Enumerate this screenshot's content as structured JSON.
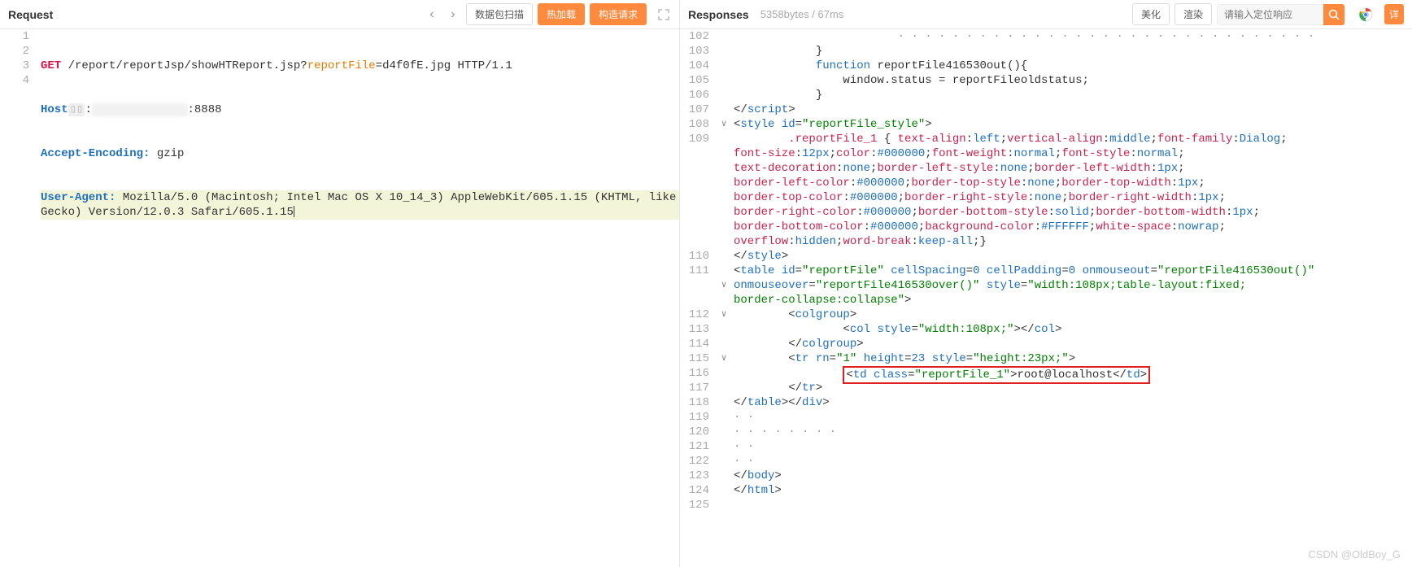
{
  "left": {
    "title": "Request",
    "nav_prev": "‹",
    "nav_next": "›",
    "btn_scan": "数据包扫描",
    "btn_hot": "热加载",
    "btn_build": "构造请求",
    "lines": [
      "1",
      "2",
      "3",
      "4"
    ],
    "l1": {
      "method": "GET",
      "path": "/report/reportJsp/showHTReport.jsp?",
      "param": "reportFile",
      "eq": "=d4f0fE.jpg",
      "proto": "HTTP/1.1"
    },
    "l2": {
      "header": "Host",
      "redacted": "▯▯",
      "dotsep": ":",
      "maskedhost": "              ",
      "port": ":8888"
    },
    "l3": {
      "header": "Accept-Encoding:",
      "value": "gzip"
    },
    "l4": {
      "header": "User-Agent:",
      "value": "Mozilla/5.0 (Macintosh; Intel Mac OS X 10_14_3) AppleWebKit/605.1.15 (KHTML, like Gecko) Version/12.0.3 Safari/605.1.15"
    }
  },
  "right": {
    "title": "Responses",
    "meta": "5358bytes / 67ms",
    "btn_beautify": "美化",
    "btn_render": "渲染",
    "search_placeholder": "请输入定位响应",
    "btn_detail": "详",
    "rows": [
      {
        "n": "102",
        "fold": "",
        "indent": 6,
        "segs": [
          {
            "c": "k-gray",
            "t": "· · · · · · · · · · · · · · · · · · · · · · · · · · · · · · ·"
          }
        ]
      },
      {
        "n": "103",
        "fold": "",
        "indent": 3,
        "segs": [
          {
            "c": "k-text",
            "t": "}"
          }
        ]
      },
      {
        "n": "104",
        "fold": "",
        "indent": 3,
        "segs": [
          {
            "c": "k-blue",
            "t": "function"
          },
          {
            "c": "k-text",
            "t": " reportFile416530out(){"
          }
        ]
      },
      {
        "n": "105",
        "fold": "",
        "indent": 4,
        "segs": [
          {
            "c": "k-text",
            "t": "window.status = reportFileoldstatus;"
          }
        ]
      },
      {
        "n": "106",
        "fold": "",
        "indent": 3,
        "segs": [
          {
            "c": "k-text",
            "t": "}"
          }
        ]
      },
      {
        "n": "107",
        "fold": "",
        "indent": 0,
        "segs": [
          {
            "c": "k-text",
            "t": "</"
          },
          {
            "c": "k-blue",
            "t": "script"
          },
          {
            "c": "k-text",
            "t": ">"
          }
        ]
      },
      {
        "n": "108",
        "fold": "∨",
        "indent": 0,
        "segs": [
          {
            "c": "k-text",
            "t": "<"
          },
          {
            "c": "k-blue",
            "t": "style"
          },
          {
            "c": "k-text",
            "t": " "
          },
          {
            "c": "k-blue",
            "t": "id"
          },
          {
            "c": "k-text",
            "t": "="
          },
          {
            "c": "k-str",
            "t": "\"reportFile_style\""
          },
          {
            "c": "k-text",
            "t": ">"
          }
        ]
      },
      {
        "n": "109",
        "fold": "",
        "multi": true,
        "indent": 2,
        "segs": [
          {
            "c": "k-red",
            "t": ".reportFile_1"
          },
          {
            "c": "k-text",
            "t": " { "
          },
          {
            "c": "k-red",
            "t": "text-align"
          },
          {
            "c": "k-text",
            "t": ":"
          },
          {
            "c": "k-blue",
            "t": "left"
          },
          {
            "c": "k-text",
            "t": ";"
          },
          {
            "c": "k-red",
            "t": "vertical-align"
          },
          {
            "c": "k-text",
            "t": ":"
          },
          {
            "c": "k-blue",
            "t": "middle"
          },
          {
            "c": "k-text",
            "t": ";"
          },
          {
            "c": "k-red",
            "t": "font-family"
          },
          {
            "c": "k-text",
            "t": ":"
          },
          {
            "c": "k-blue",
            "t": "Dialog"
          },
          {
            "c": "k-text",
            "t": ";\n"
          },
          {
            "c": "k-red",
            "t": "font-size"
          },
          {
            "c": "k-text",
            "t": ":"
          },
          {
            "c": "k-num",
            "t": "12px"
          },
          {
            "c": "k-text",
            "t": ";"
          },
          {
            "c": "k-red",
            "t": "color"
          },
          {
            "c": "k-text",
            "t": ":"
          },
          {
            "c": "k-blue",
            "t": "#000000"
          },
          {
            "c": "k-text",
            "t": ";"
          },
          {
            "c": "k-red",
            "t": "font-weight"
          },
          {
            "c": "k-text",
            "t": ":"
          },
          {
            "c": "k-blue",
            "t": "normal"
          },
          {
            "c": "k-text",
            "t": ";"
          },
          {
            "c": "k-red",
            "t": "font-style"
          },
          {
            "c": "k-text",
            "t": ":"
          },
          {
            "c": "k-blue",
            "t": "normal"
          },
          {
            "c": "k-text",
            "t": ";\n"
          },
          {
            "c": "k-red",
            "t": "text-decoration"
          },
          {
            "c": "k-text",
            "t": ":"
          },
          {
            "c": "k-blue",
            "t": "none"
          },
          {
            "c": "k-text",
            "t": ";"
          },
          {
            "c": "k-red",
            "t": "border-left-style"
          },
          {
            "c": "k-text",
            "t": ":"
          },
          {
            "c": "k-blue",
            "t": "none"
          },
          {
            "c": "k-text",
            "t": ";"
          },
          {
            "c": "k-red",
            "t": "border-left-width"
          },
          {
            "c": "k-text",
            "t": ":"
          },
          {
            "c": "k-num",
            "t": "1px"
          },
          {
            "c": "k-text",
            "t": ";\n"
          },
          {
            "c": "k-red",
            "t": "border-left-color"
          },
          {
            "c": "k-text",
            "t": ":"
          },
          {
            "c": "k-blue",
            "t": "#000000"
          },
          {
            "c": "k-text",
            "t": ";"
          },
          {
            "c": "k-red",
            "t": "border-top-style"
          },
          {
            "c": "k-text",
            "t": ":"
          },
          {
            "c": "k-blue",
            "t": "none"
          },
          {
            "c": "k-text",
            "t": ";"
          },
          {
            "c": "k-red",
            "t": "border-top-width"
          },
          {
            "c": "k-text",
            "t": ":"
          },
          {
            "c": "k-num",
            "t": "1px"
          },
          {
            "c": "k-text",
            "t": ";\n"
          },
          {
            "c": "k-red",
            "t": "border-top-color"
          },
          {
            "c": "k-text",
            "t": ":"
          },
          {
            "c": "k-blue",
            "t": "#000000"
          },
          {
            "c": "k-text",
            "t": ";"
          },
          {
            "c": "k-red",
            "t": "border-right-style"
          },
          {
            "c": "k-text",
            "t": ":"
          },
          {
            "c": "k-blue",
            "t": "none"
          },
          {
            "c": "k-text",
            "t": ";"
          },
          {
            "c": "k-red",
            "t": "border-right-width"
          },
          {
            "c": "k-text",
            "t": ":"
          },
          {
            "c": "k-num",
            "t": "1px"
          },
          {
            "c": "k-text",
            "t": ";\n"
          },
          {
            "c": "k-red",
            "t": "border-right-color"
          },
          {
            "c": "k-text",
            "t": ":"
          },
          {
            "c": "k-blue",
            "t": "#000000"
          },
          {
            "c": "k-text",
            "t": ";"
          },
          {
            "c": "k-red",
            "t": "border-bottom-style"
          },
          {
            "c": "k-text",
            "t": ":"
          },
          {
            "c": "k-blue",
            "t": "solid"
          },
          {
            "c": "k-text",
            "t": ";"
          },
          {
            "c": "k-red",
            "t": "border-bottom-width"
          },
          {
            "c": "k-text",
            "t": ":"
          },
          {
            "c": "k-num",
            "t": "1px"
          },
          {
            "c": "k-text",
            "t": ";\n"
          },
          {
            "c": "k-red",
            "t": "border-bottom-color"
          },
          {
            "c": "k-text",
            "t": ":"
          },
          {
            "c": "k-blue",
            "t": "#000000"
          },
          {
            "c": "k-text",
            "t": ";"
          },
          {
            "c": "k-red",
            "t": "background-color"
          },
          {
            "c": "k-text",
            "t": ":"
          },
          {
            "c": "k-blue",
            "t": "#FFFFFF"
          },
          {
            "c": "k-text",
            "t": ";"
          },
          {
            "c": "k-red",
            "t": "white-space"
          },
          {
            "c": "k-text",
            "t": ":"
          },
          {
            "c": "k-blue",
            "t": "nowrap"
          },
          {
            "c": "k-text",
            "t": ";\n"
          },
          {
            "c": "k-red",
            "t": "overflow"
          },
          {
            "c": "k-text",
            "t": ":"
          },
          {
            "c": "k-blue",
            "t": "hidden"
          },
          {
            "c": "k-text",
            "t": ";"
          },
          {
            "c": "k-red",
            "t": "word-break"
          },
          {
            "c": "k-text",
            "t": ":"
          },
          {
            "c": "k-blue",
            "t": "keep-all"
          },
          {
            "c": "k-text",
            "t": ";}"
          }
        ]
      },
      {
        "n": "110",
        "fold": "",
        "indent": 0,
        "segs": [
          {
            "c": "k-text",
            "t": "</"
          },
          {
            "c": "k-blue",
            "t": "style"
          },
          {
            "c": "k-text",
            "t": ">"
          }
        ]
      },
      {
        "n": "111",
        "fold": "∨",
        "multi": true,
        "indent": 0,
        "segs": [
          {
            "c": "k-text",
            "t": "<"
          },
          {
            "c": "k-blue",
            "t": "table"
          },
          {
            "c": "k-text",
            "t": " "
          },
          {
            "c": "k-blue",
            "t": "id"
          },
          {
            "c": "k-text",
            "t": "="
          },
          {
            "c": "k-str",
            "t": "\"reportFile\""
          },
          {
            "c": "k-text",
            "t": " "
          },
          {
            "c": "k-blue",
            "t": "cellSpacing"
          },
          {
            "c": "k-text",
            "t": "="
          },
          {
            "c": "k-num",
            "t": "0"
          },
          {
            "c": "k-text",
            "t": " "
          },
          {
            "c": "k-blue",
            "t": "cellPadding"
          },
          {
            "c": "k-text",
            "t": "="
          },
          {
            "c": "k-num",
            "t": "0"
          },
          {
            "c": "k-text",
            "t": " "
          },
          {
            "c": "k-blue",
            "t": "onmouseout"
          },
          {
            "c": "k-text",
            "t": "="
          },
          {
            "c": "k-str",
            "t": "\"reportFile416530out()\""
          },
          {
            "c": "k-text",
            "t": "\n"
          },
          {
            "c": "k-blue",
            "t": "onmouseover"
          },
          {
            "c": "k-text",
            "t": "="
          },
          {
            "c": "k-str",
            "t": "\"reportFile416530over()\""
          },
          {
            "c": "k-text",
            "t": " "
          },
          {
            "c": "k-blue",
            "t": "style"
          },
          {
            "c": "k-text",
            "t": "="
          },
          {
            "c": "k-str",
            "t": "\"width:108px;table-layout:fixed;\nborder-collapse:collapse\""
          },
          {
            "c": "k-text",
            "t": ">"
          }
        ]
      },
      {
        "n": "112",
        "fold": "∨",
        "indent": 2,
        "segs": [
          {
            "c": "k-text",
            "t": "<"
          },
          {
            "c": "k-blue",
            "t": "colgroup"
          },
          {
            "c": "k-text",
            "t": ">"
          }
        ]
      },
      {
        "n": "113",
        "fold": "",
        "indent": 4,
        "segs": [
          {
            "c": "k-text",
            "t": "<"
          },
          {
            "c": "k-blue",
            "t": "col"
          },
          {
            "c": "k-text",
            "t": " "
          },
          {
            "c": "k-blue",
            "t": "style"
          },
          {
            "c": "k-text",
            "t": "="
          },
          {
            "c": "k-str",
            "t": "\"width:108px;\""
          },
          {
            "c": "k-text",
            "t": "></"
          },
          {
            "c": "k-blue",
            "t": "col"
          },
          {
            "c": "k-text",
            "t": ">"
          }
        ]
      },
      {
        "n": "114",
        "fold": "",
        "indent": 2,
        "segs": [
          {
            "c": "k-text",
            "t": "</"
          },
          {
            "c": "k-blue",
            "t": "colgroup"
          },
          {
            "c": "k-text",
            "t": ">"
          }
        ]
      },
      {
        "n": "115",
        "fold": "∨",
        "indent": 2,
        "segs": [
          {
            "c": "k-text",
            "t": "<"
          },
          {
            "c": "k-blue",
            "t": "tr"
          },
          {
            "c": "k-text",
            "t": " "
          },
          {
            "c": "k-blue",
            "t": "rn"
          },
          {
            "c": "k-text",
            "t": "="
          },
          {
            "c": "k-str",
            "t": "\"1\""
          },
          {
            "c": "k-text",
            "t": " "
          },
          {
            "c": "k-blue",
            "t": "height"
          },
          {
            "c": "k-text",
            "t": "="
          },
          {
            "c": "k-num",
            "t": "23"
          },
          {
            "c": "k-text",
            "t": " "
          },
          {
            "c": "k-blue",
            "t": "style"
          },
          {
            "c": "k-text",
            "t": "="
          },
          {
            "c": "k-str",
            "t": "\"height:23px;\""
          },
          {
            "c": "k-text",
            "t": ">"
          }
        ]
      },
      {
        "n": "116",
        "fold": "",
        "indent": 4,
        "redbox": true,
        "segs": [
          {
            "c": "k-text",
            "t": "<"
          },
          {
            "c": "k-blue",
            "t": "td"
          },
          {
            "c": "k-text",
            "t": " "
          },
          {
            "c": "k-blue",
            "t": "class"
          },
          {
            "c": "k-text",
            "t": "="
          },
          {
            "c": "k-str",
            "t": "\"reportFile_1\""
          },
          {
            "c": "k-text",
            "t": ">root@localhost</"
          },
          {
            "c": "k-blue",
            "t": "td"
          },
          {
            "c": "k-text",
            "t": ">"
          }
        ]
      },
      {
        "n": "117",
        "fold": "",
        "indent": 2,
        "segs": [
          {
            "c": "k-text",
            "t": "</"
          },
          {
            "c": "k-blue",
            "t": "tr"
          },
          {
            "c": "k-text",
            "t": ">"
          }
        ]
      },
      {
        "n": "118",
        "fold": "",
        "indent": 0,
        "segs": [
          {
            "c": "k-text",
            "t": "</"
          },
          {
            "c": "k-blue",
            "t": "table"
          },
          {
            "c": "k-text",
            "t": "></"
          },
          {
            "c": "k-blue",
            "t": "div"
          },
          {
            "c": "k-text",
            "t": ">"
          }
        ]
      },
      {
        "n": "119",
        "fold": "",
        "indent": 0,
        "segs": [
          {
            "c": "k-gray",
            "t": "· ·"
          }
        ]
      },
      {
        "n": "120",
        "fold": "",
        "indent": 0,
        "segs": [
          {
            "c": "k-gray",
            "t": "· · · · · · · ·"
          }
        ]
      },
      {
        "n": "121",
        "fold": "",
        "indent": 0,
        "segs": [
          {
            "c": "k-gray",
            "t": "· ·"
          }
        ]
      },
      {
        "n": "122",
        "fold": "",
        "indent": 0,
        "segs": [
          {
            "c": "k-gray",
            "t": "· ·"
          }
        ]
      },
      {
        "n": "123",
        "fold": "",
        "indent": 0,
        "segs": [
          {
            "c": "k-text",
            "t": "</"
          },
          {
            "c": "k-blue",
            "t": "body"
          },
          {
            "c": "k-text",
            "t": ">"
          }
        ]
      },
      {
        "n": "124",
        "fold": "",
        "indent": 0,
        "segs": [
          {
            "c": "k-text",
            "t": "</"
          },
          {
            "c": "k-blue",
            "t": "html"
          },
          {
            "c": "k-text",
            "t": ">"
          }
        ]
      },
      {
        "n": "125",
        "fold": "",
        "indent": 0,
        "segs": []
      }
    ]
  },
  "watermark": "CSDN @OldBoy_G"
}
